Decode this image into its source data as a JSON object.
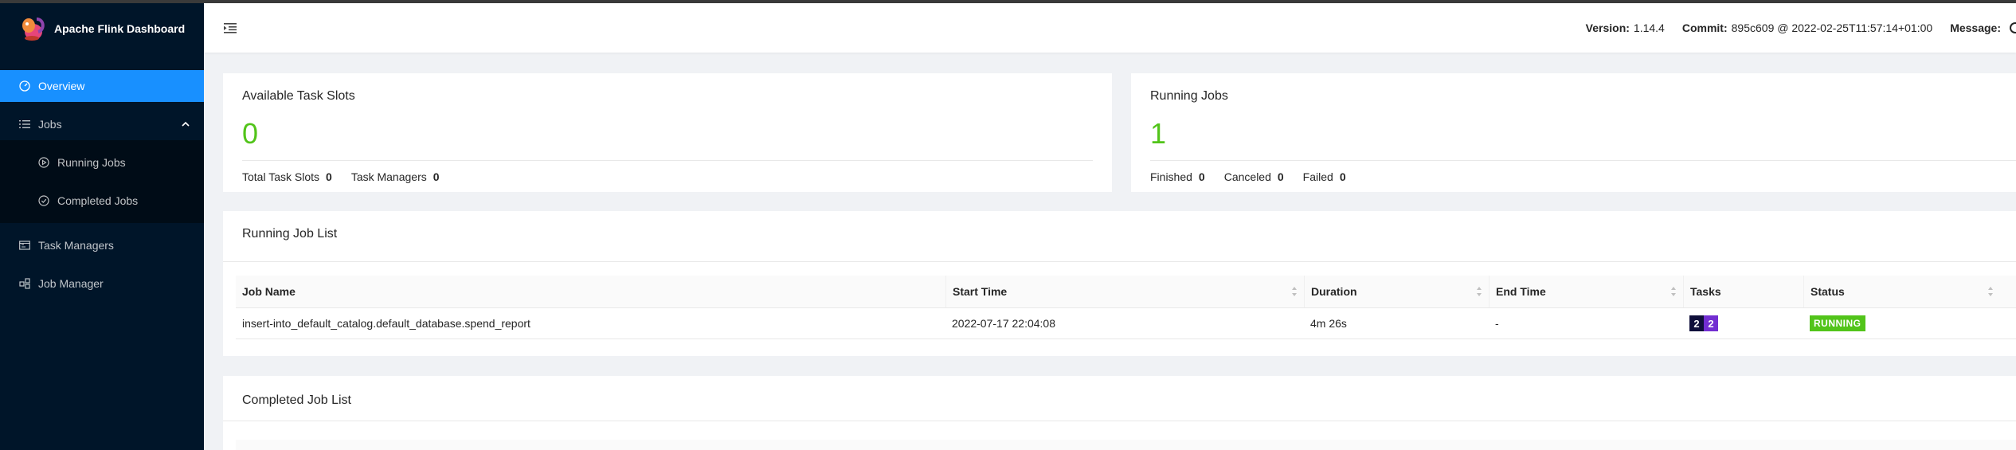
{
  "app": {
    "title": "Apache Flink Dashboard"
  },
  "sidebar": {
    "items": [
      {
        "label": "Overview",
        "icon": "dashboard-icon",
        "active": true
      },
      {
        "label": "Jobs",
        "icon": "list-icon",
        "expanded": true,
        "children": [
          {
            "label": "Running Jobs",
            "icon": "play-circle-icon"
          },
          {
            "label": "Completed Jobs",
            "icon": "check-circle-icon"
          }
        ]
      },
      {
        "label": "Task Managers",
        "icon": "schedule-icon"
      },
      {
        "label": "Job Manager",
        "icon": "cluster-icon"
      }
    ]
  },
  "header": {
    "version_label": "Version:",
    "version": "1.14.4",
    "commit_label": "Commit:",
    "commit": "895c609 @ 2022-02-25T11:57:14+01:00",
    "message_label": "Message:"
  },
  "slots_card": {
    "title": "Available Task Slots",
    "value": "0",
    "stats": [
      {
        "label": "Total Task Slots",
        "value": "0"
      },
      {
        "label": "Task Managers",
        "value": "0"
      }
    ]
  },
  "jobs_card": {
    "title": "Running Jobs",
    "value": "1",
    "stats": [
      {
        "label": "Finished",
        "value": "0"
      },
      {
        "label": "Canceled",
        "value": "0"
      },
      {
        "label": "Failed",
        "value": "0"
      }
    ]
  },
  "running_list": {
    "title": "Running Job List",
    "columns": [
      "Job Name",
      "Start Time",
      "Duration",
      "End Time",
      "Tasks",
      "Status"
    ],
    "rows": [
      {
        "job_name": "insert-into_default_catalog.default_database.spend_report",
        "start_time": "2022-07-17 22:04:08",
        "duration": "4m 26s",
        "end_time": "-",
        "tasks": [
          "2",
          "2"
        ],
        "status": "RUNNING"
      }
    ]
  },
  "completed_list": {
    "title": "Completed Job List"
  },
  "colors": {
    "sidebar": "#001529",
    "active": "#1890ff",
    "success": "#52c41a",
    "tasks_running": "#722ed1",
    "tasks_total": "#0f0f3a"
  }
}
